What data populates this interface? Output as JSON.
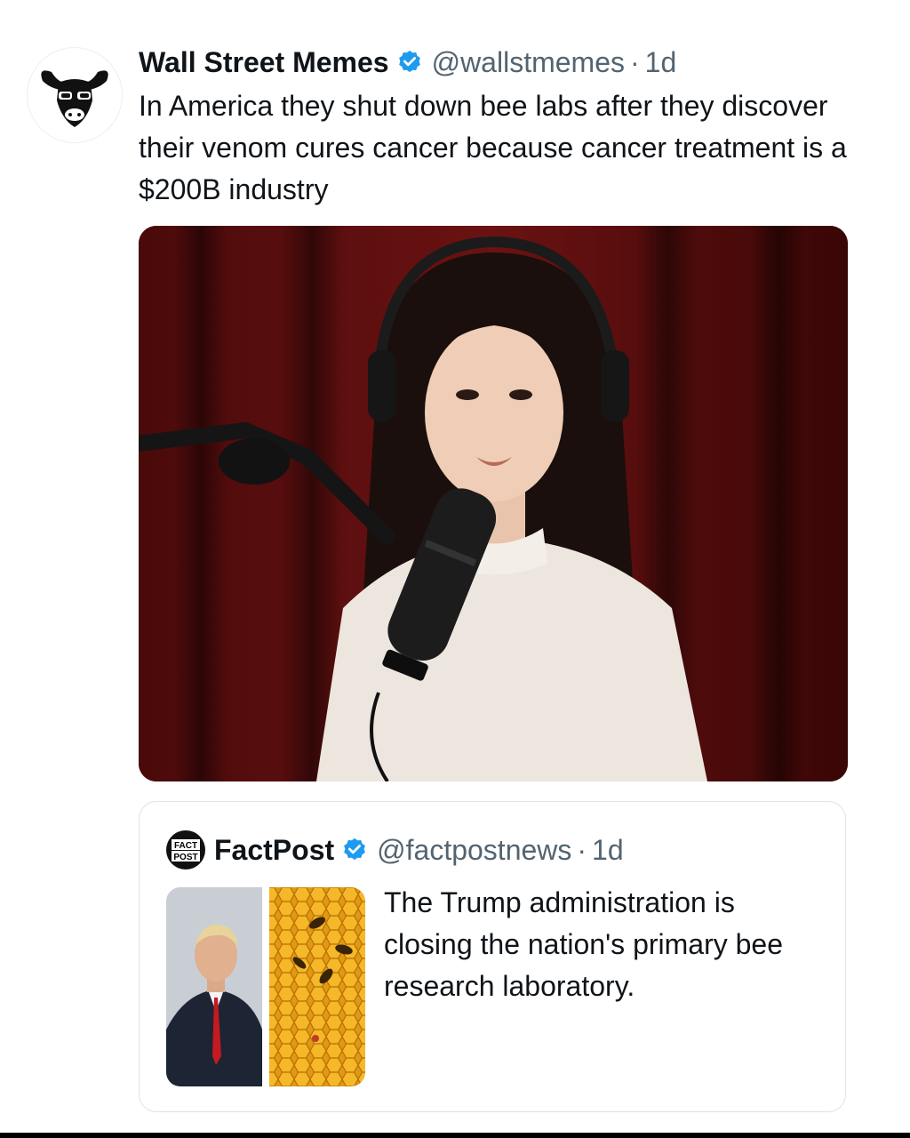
{
  "post": {
    "display_name": "Wall Street Memes",
    "handle": "@wallstmemes",
    "separator": "·",
    "time": "1d",
    "text": "In America they shut down bee labs after they discover their venom cures cancer because cancer treatment is a $200B industry",
    "avatar_icon": "bull-logo-icon",
    "verified_icon": "verified-badge-icon"
  },
  "quoted_post": {
    "display_name": "FactPost",
    "handle": "@factpostnews",
    "separator": "·",
    "time": "1d",
    "text": "The Trump administration is closing the nation's primary bee research laboratory.",
    "avatar_logo_text": [
      "FACT",
      "POST"
    ],
    "verified_icon": "verified-badge-icon"
  },
  "colors": {
    "verified": "#1d9bf0",
    "secondary_text": "#536471",
    "border": "#dfe3e6"
  }
}
